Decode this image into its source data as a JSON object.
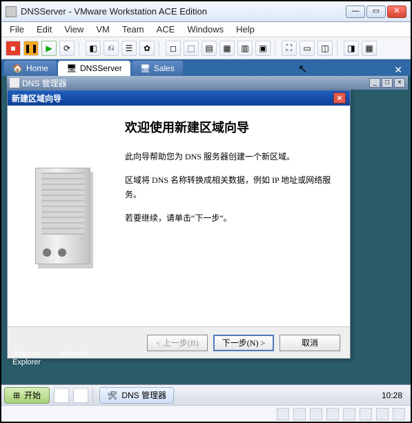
{
  "vmware": {
    "title": "DNSServer - VMware Workstation ACE Edition",
    "menu": [
      "File",
      "Edit",
      "View",
      "VM",
      "Team",
      "ACE",
      "Windows",
      "Help"
    ],
    "tabs": {
      "home": "Home",
      "active": "DNSServer",
      "other": "Sales"
    }
  },
  "mmc": {
    "title": "DNS 管理器"
  },
  "wizard": {
    "title": "新建区域向导",
    "heading": "欢迎使用新建区域向导",
    "p1": "此向导帮助您为 DNS 服务器创建一个新区域。",
    "p2": "区域将 DNS 名称转换成相关数据，例如 IP 地址或网络服务。",
    "p3": "若要继续，请单击“下一步”。",
    "back": "< 上一步(B)",
    "next": "下一步(N) >",
    "cancel": "取消"
  },
  "desktop": {
    "icon1": "Internet\nExplorer",
    "icon2": "ethereal-..."
  },
  "guest_taskbar": {
    "start": "开始",
    "task": "DNS 管理器",
    "clock": "10:28"
  }
}
